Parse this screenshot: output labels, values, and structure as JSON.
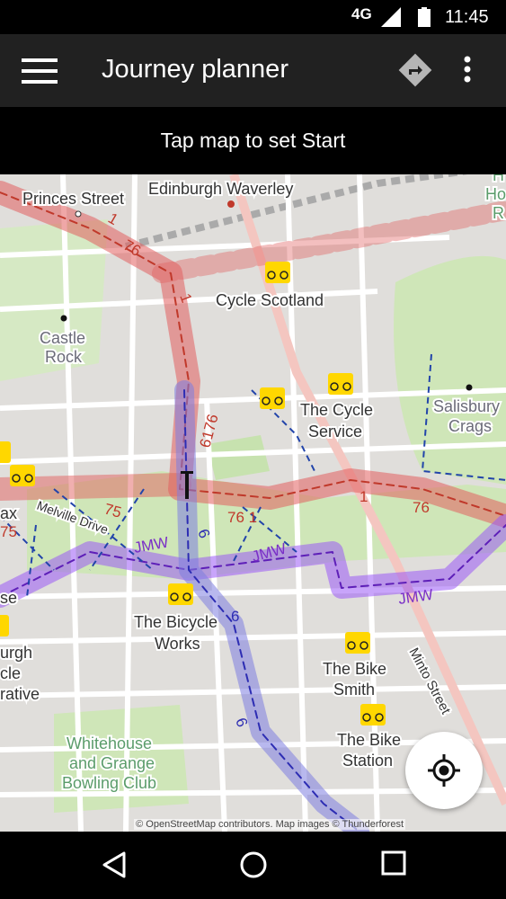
{
  "status_bar": {
    "network": "4G",
    "time": "11:45",
    "icons": [
      "signal-icon",
      "battery-icon"
    ]
  },
  "app_bar": {
    "title": "Journey planner",
    "icons": [
      "menu-icon",
      "directions-icon",
      "more-vert-icon"
    ]
  },
  "hint": {
    "text": "Tap map to set Start"
  },
  "map": {
    "places": {
      "princes_street": "Princes Street",
      "edinburgh_waverley": "Edinburgh Waverley",
      "cycle_scotland": "Cycle Scotland",
      "castle_rock_1": "Castle",
      "castle_rock_2": "Rock",
      "the_cycle_service_1": "The Cycle",
      "the_cycle_service_2": "Service",
      "salisbury_crags_1": "Salisbury",
      "salisbury_crags_2": "Crags",
      "melville_drive": "Melville Drive",
      "the_bicycle_works_1": "The Bicycle",
      "the_bicycle_works_2": "Works",
      "the_bike_smith_1": "The Bike",
      "the_bike_smith_2": "Smith",
      "the_bike_station_1": "The Bike",
      "the_bike_station_2": "Station",
      "whitehouse_1": "Whitehouse",
      "whitehouse_2": "and Grange",
      "whitehouse_3": "Bowling Club",
      "minto_street": "Minto Street",
      "edge_fax": "ax",
      "edge_urgh": "urgh",
      "edge_cle": "cle",
      "edge_rative": "rative",
      "edge_se": "se",
      "edge_ho_1": "H",
      "edge_ho_2": "Ho",
      "edge_ho_3": "R"
    },
    "route_labels": {
      "r1_top": "1",
      "r76_top": "76",
      "r1_mid": "1",
      "r6176": "6176",
      "r75_left": "75",
      "r75_edge": "75",
      "r761": "76 1",
      "r1_right": "1",
      "r76_right": "76",
      "r6": "6",
      "r6_lower": "6",
      "r6_bottom": "6",
      "jmw_1": "JMW",
      "jmw_2": "JMW",
      "jmw_3": "JMW"
    },
    "attribution": "© OpenStreetMap contributors. Map images © Thunderforest",
    "colors": {
      "ncn_red": "#e25f5f",
      "jmw_purple": "#9b59f5",
      "route6_blue": "#7d7de0",
      "park_green": "#cfe6b8",
      "bike_marker": "#ffd700"
    }
  },
  "locate_button": {
    "icon": "my-location-icon"
  },
  "nav_bar": {
    "icons": [
      "back-icon",
      "home-icon",
      "recents-icon"
    ]
  }
}
